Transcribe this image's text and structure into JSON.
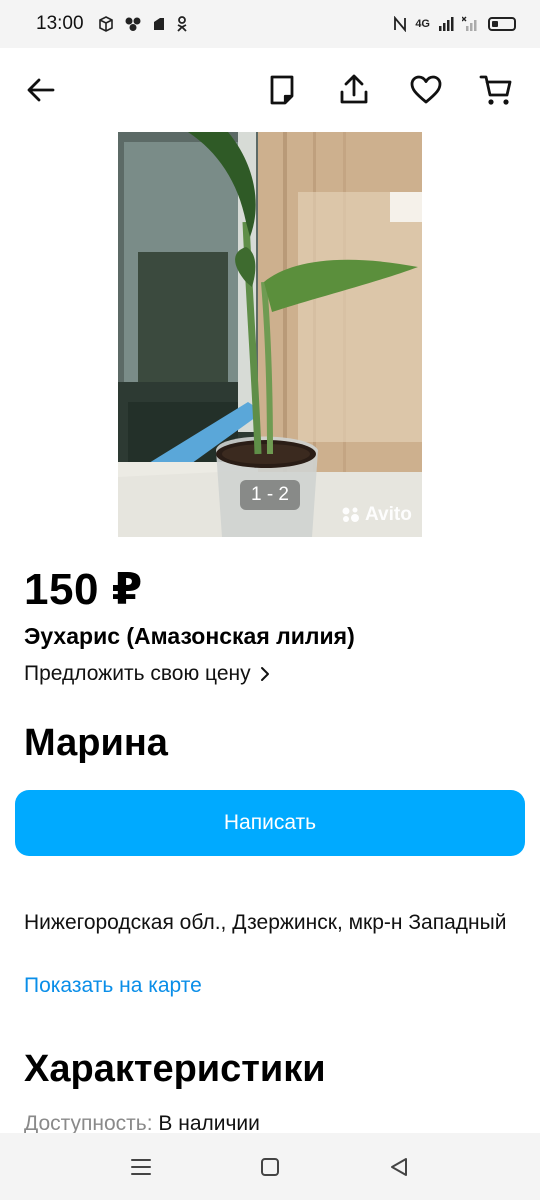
{
  "status_bar": {
    "time": "13:00",
    "network": "4G",
    "icons": [
      "cube-icon",
      "clover-icon",
      "app-icon",
      "ok-icon",
      "nfc-icon",
      "signal-icon",
      "no-signal-icon",
      "battery-icon"
    ],
    "battery_level": 0.3
  },
  "toolbar": {
    "icons": [
      "back-arrow-icon",
      "note-icon",
      "share-icon",
      "heart-icon",
      "cart-icon"
    ]
  },
  "gallery": {
    "counter": "1 - 2",
    "watermark": "Avito"
  },
  "listing": {
    "price": "150 ₽",
    "title": "Эухарис (Амазонская лилия)",
    "offer_label": "Предложить свою цену",
    "seller": "Марина",
    "write_button": "Написать",
    "address": "Нижегородская обл., Дзержинск, мкр-н Западный",
    "map_link": "Показать на карте",
    "section_title": "Характеристики",
    "spec_key": "Доступность:",
    "spec_value": "В наличии"
  },
  "colors": {
    "accent": "#00aaff",
    "link": "#0a8ee8"
  },
  "nav_bar": {
    "icons": [
      "menu-icon",
      "home-square-icon",
      "back-triangle-icon"
    ]
  }
}
